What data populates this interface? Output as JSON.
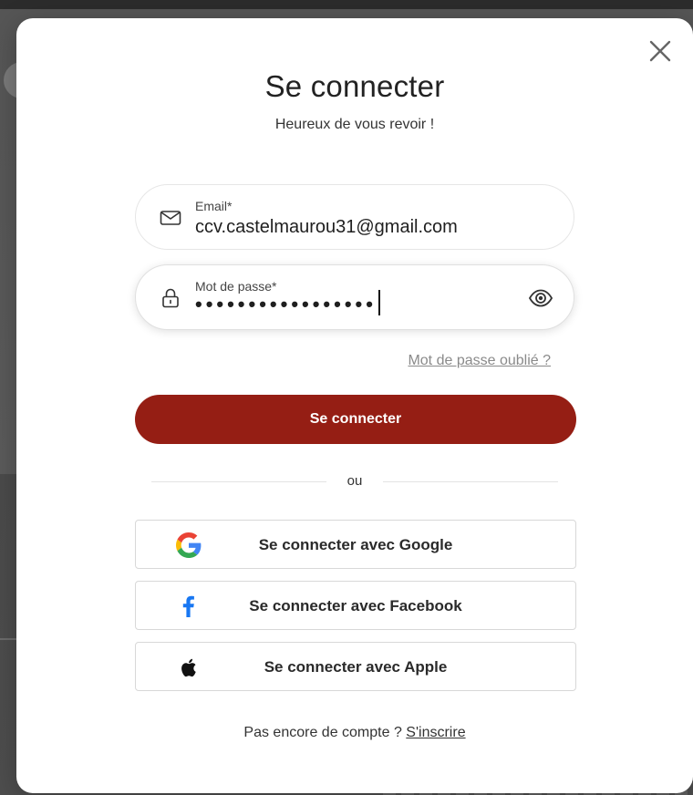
{
  "modal": {
    "title": "Se connecter",
    "subtitle": "Heureux de vous revoir !"
  },
  "email": {
    "label": "Email*",
    "value": "ccv.castelmaurou31@gmail.com"
  },
  "password": {
    "label": "Mot de passe*",
    "masked_value": "•••••••••••••••••"
  },
  "forgot_password": "Mot de passe oublié ?",
  "submit_label": "Se connecter",
  "divider_text": "ou",
  "social": {
    "google_label": "Se connecter avec Google",
    "facebook_label": "Se connecter avec Facebook",
    "apple_label": "Se connecter avec Apple"
  },
  "signup": {
    "prompt": "Pas encore de compte ?",
    "link": "S'inscrire"
  },
  "colors": {
    "primary": "#951e14",
    "facebook": "#1877f2",
    "google_blue": "#4285f4",
    "google_red": "#ea4335",
    "google_yellow": "#fbbc05",
    "google_green": "#34a853"
  },
  "icons": {
    "close": "close-icon",
    "email": "mail-icon",
    "password": "lock-icon",
    "visibility": "eye-icon",
    "google": "google-icon",
    "facebook": "facebook-icon",
    "apple": "apple-icon"
  }
}
